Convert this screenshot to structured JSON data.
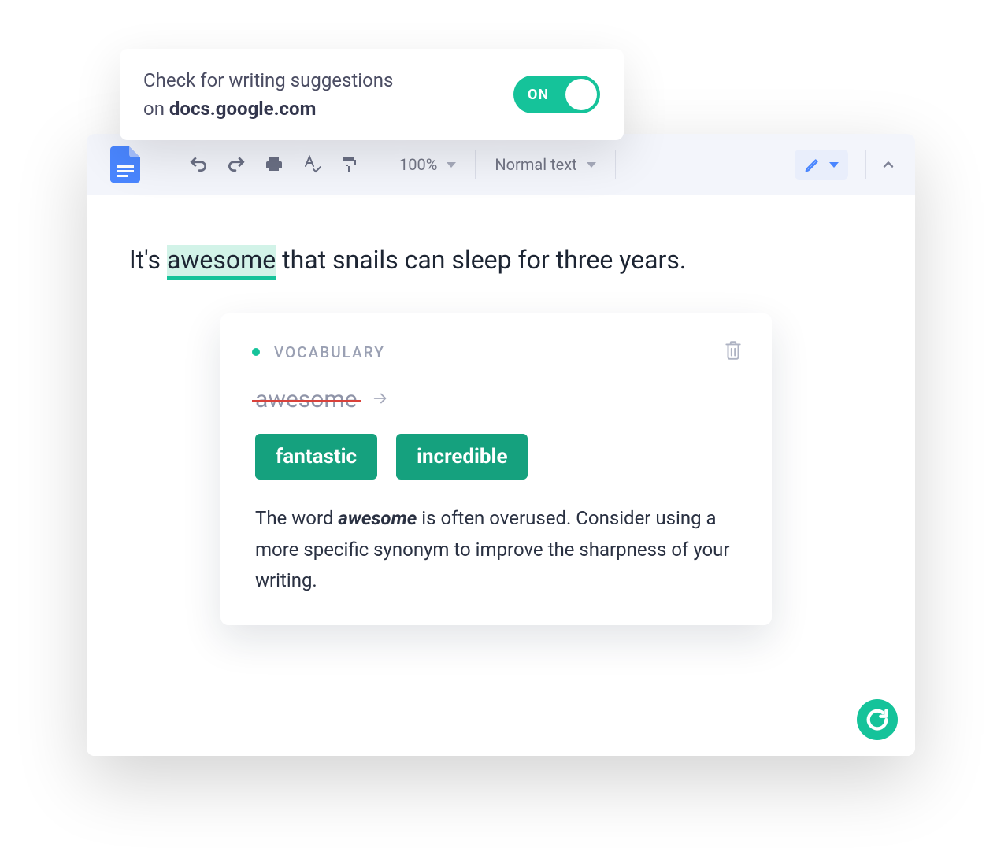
{
  "popup": {
    "line1": "Check for writing suggestions",
    "line2_prefix": "on ",
    "domain": "docs.google.com",
    "toggle_state": "ON"
  },
  "toolbar": {
    "zoom": "100%",
    "style": "Normal text"
  },
  "document": {
    "text_before": "It's ",
    "highlighted": "awesome",
    "text_after": " that snails can sleep for three years."
  },
  "suggestion": {
    "category": "VOCABULARY",
    "original": "awesome",
    "replacements": [
      "fantastic",
      "incredible"
    ],
    "explanation_before": "The word ",
    "explanation_word": "awesome",
    "explanation_after": " is often overused. Consider using a more specific synonym to improve the sharpness of your writing."
  },
  "colors": {
    "accent": "#15c39a",
    "chip": "#15a17e"
  }
}
